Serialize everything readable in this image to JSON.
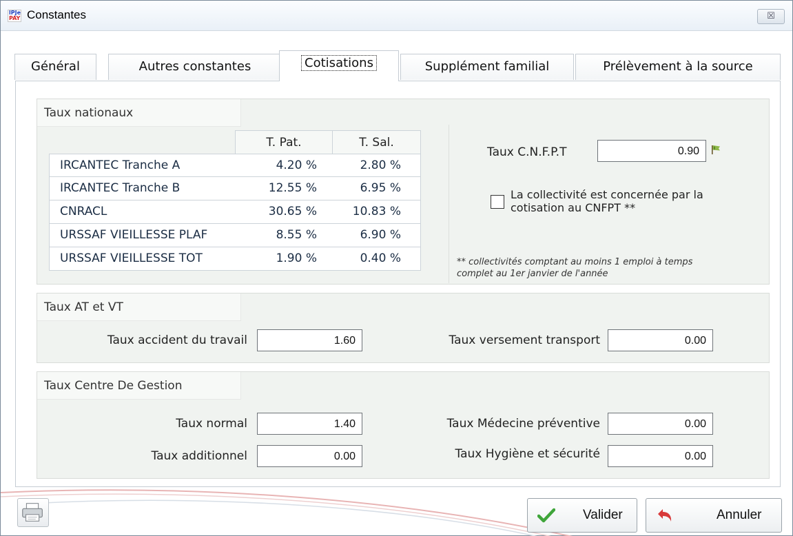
{
  "window": {
    "title": "Constantes",
    "app_icon": [
      "lPJe",
      "PAY"
    ],
    "icon": "app-logo-icon",
    "close_label": "☒"
  },
  "tabs": [
    {
      "label": "Général",
      "active": false
    },
    {
      "label": "Autres constantes",
      "active": false
    },
    {
      "label": "Cotisations",
      "active": true
    },
    {
      "label": "Supplément familial",
      "active": false
    },
    {
      "label": "Prélèvement à la source",
      "active": false
    }
  ],
  "taux_nationaux": {
    "group_label": "Taux nationaux",
    "col_pat": "T. Pat.",
    "col_sal": "T. Sal.",
    "rows": [
      {
        "name": "IRCANTEC Tranche A",
        "pat": "4.20 %",
        "sal": "2.80 %"
      },
      {
        "name": "IRCANTEC Tranche B",
        "pat": "12.55 %",
        "sal": "6.95 %"
      },
      {
        "name": "CNRACL",
        "pat": "30.65 %",
        "sal": "10.83 %"
      },
      {
        "name": "URSSAF VIEILLESSE PLAF",
        "pat": "8.55 %",
        "sal": "6.90 %"
      },
      {
        "name": "URSSAF VIEILLESSE TOT",
        "pat": "1.90 %",
        "sal": "0.40 %"
      }
    ],
    "cnfpt_label": "Taux C.N.F.P.T",
    "cnfpt_value": "0.90",
    "cnfpt_icon": "flag-icon",
    "checkbox_label_line1": "La collectivité est concernée par la",
    "checkbox_label_line2": "cotisation au CNFPT **",
    "checkbox_checked": false,
    "note_line1": "** collectivités comptant au moins 1 emploi à temps",
    "note_line2": "complet au 1er janvier de l'année"
  },
  "taux_at_vt": {
    "group_label": "Taux AT et VT",
    "accident_label": "Taux accident du travail",
    "accident_value": "1.60",
    "transport_label": "Taux versement transport",
    "transport_value": "0.00"
  },
  "taux_cdg": {
    "group_label": "Taux Centre De Gestion",
    "normal_label": "Taux normal",
    "normal_value": "1.40",
    "additionnel_label": "Taux additionnel",
    "additionnel_value": "0.00",
    "medecine_label": "Taux Médecine préventive",
    "medecine_value": "0.00",
    "hygiene_label": "Taux Hygiène et sécurité",
    "hygiene_value": "0.00"
  },
  "footer": {
    "printer_icon": "printer-icon",
    "validate_label": "Valider",
    "validate_icon": "checkmark-icon",
    "cancel_label": "Annuler",
    "cancel_icon": "undo-arrow-icon"
  },
  "colors": {
    "group_bg": "#f0f3f0",
    "check_green": "#3fa53a",
    "undo_red": "#d83a3a"
  }
}
